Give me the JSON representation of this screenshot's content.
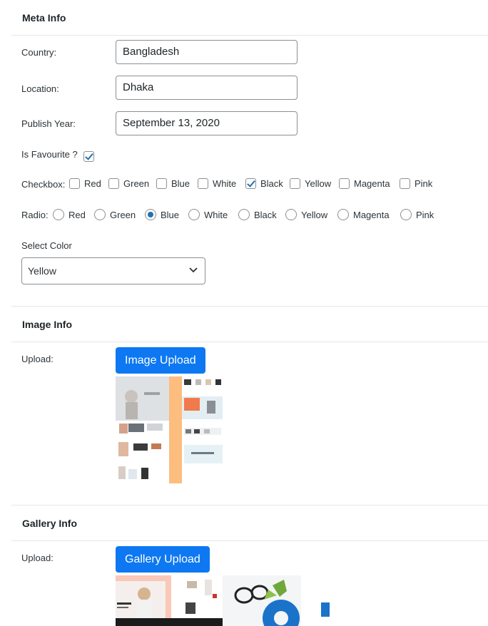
{
  "meta_info": {
    "title": "Meta Info",
    "fields": {
      "country_label": "Country:",
      "country_value": "Bangladesh",
      "location_label": "Location:",
      "location_value": "Dhaka",
      "publish_year_label": "Publish Year:",
      "publish_year_value": "September 13, 2020",
      "favourite_label": "Is Favourite ?",
      "favourite_checked": true
    },
    "checkbox_group": {
      "label": "Checkbox:",
      "options": [
        {
          "label": "Red",
          "checked": false
        },
        {
          "label": "Green",
          "checked": false
        },
        {
          "label": "Blue",
          "checked": false
        },
        {
          "label": "White",
          "checked": false
        },
        {
          "label": "Black",
          "checked": true
        },
        {
          "label": "Yellow",
          "checked": false
        },
        {
          "label": "Magenta",
          "checked": false
        },
        {
          "label": "Pink",
          "checked": false
        }
      ]
    },
    "radio_group": {
      "label": "Radio:",
      "options": [
        {
          "label": "Red",
          "selected": false
        },
        {
          "label": "Green",
          "selected": false
        },
        {
          "label": "Blue",
          "selected": true
        },
        {
          "label": "White",
          "selected": false
        },
        {
          "label": "Black",
          "selected": false
        },
        {
          "label": "Yellow",
          "selected": false
        },
        {
          "label": "Magenta",
          "selected": false
        },
        {
          "label": "Pink",
          "selected": false
        }
      ]
    },
    "select_color": {
      "label": "Select Color",
      "value": "Yellow"
    }
  },
  "image_info": {
    "title": "Image Info",
    "upload_label": "Upload:",
    "button_label": "Image Upload"
  },
  "gallery_info": {
    "title": "Gallery Info",
    "upload_label": "Upload:",
    "button_label": "Gallery Upload"
  },
  "colors": {
    "accent": "#0d78f2",
    "check": "#2271b1",
    "border": "#8c8f94",
    "divider": "#e6e6e6"
  }
}
